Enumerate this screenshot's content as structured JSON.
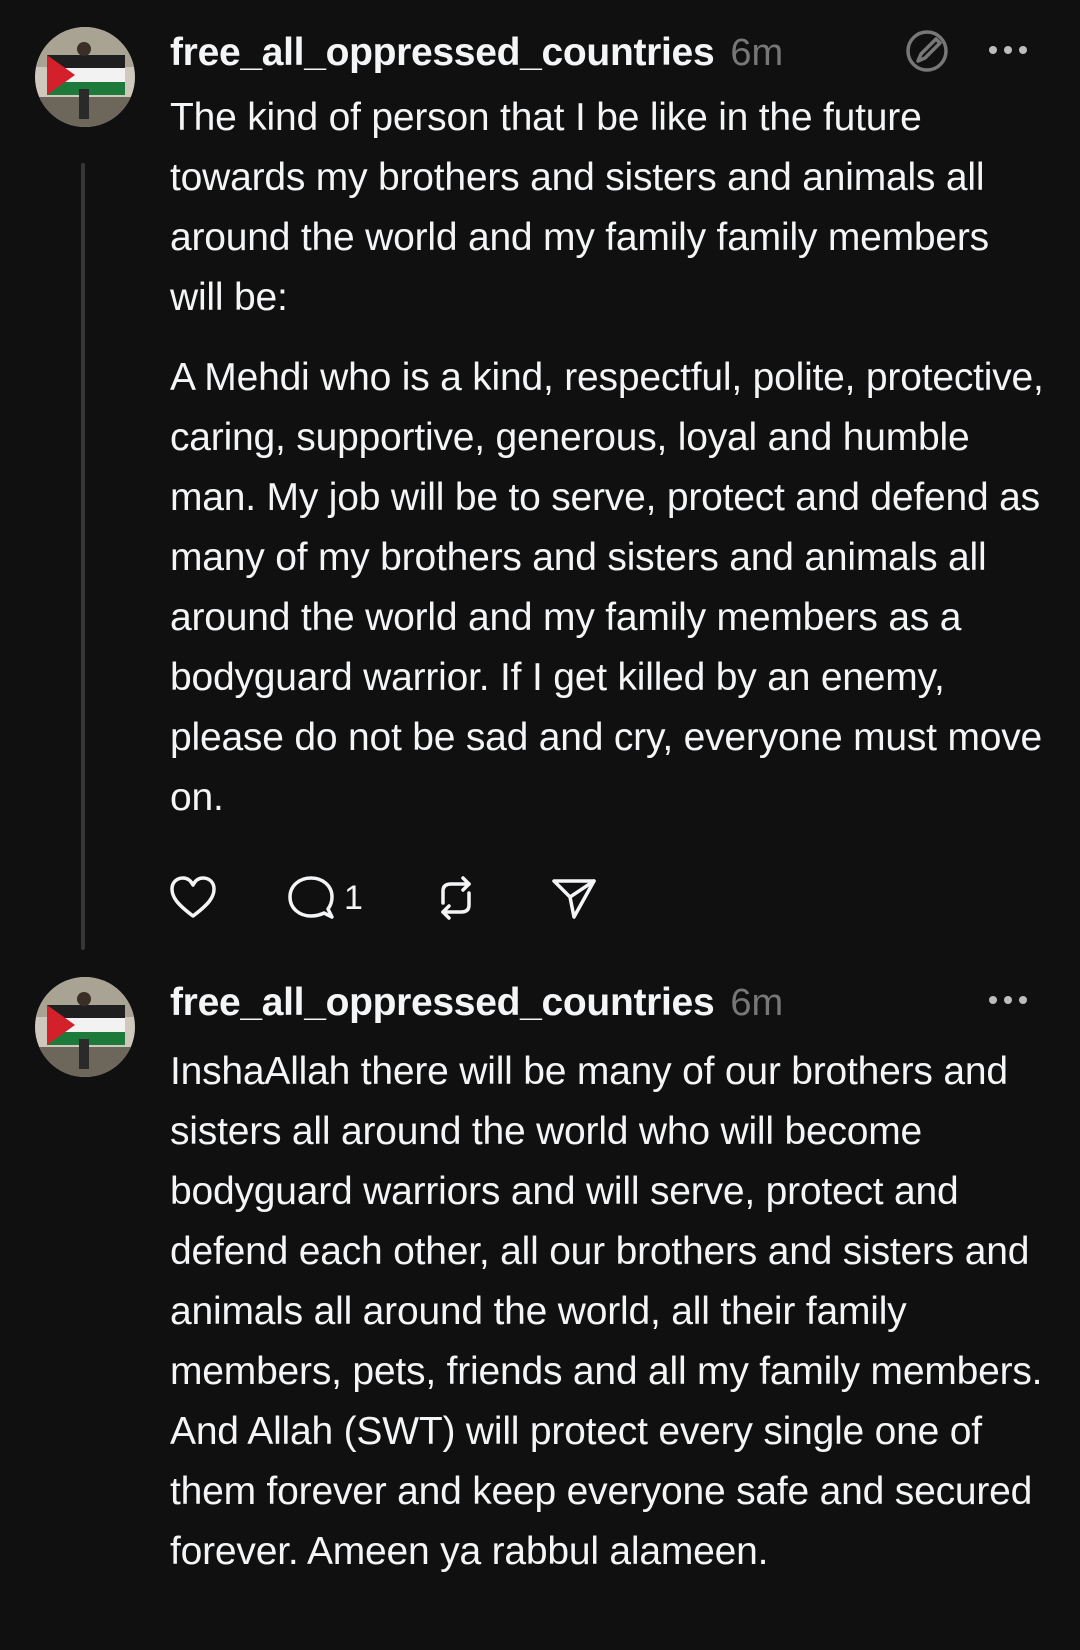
{
  "posts": [
    {
      "username": "free_all_oppressed_countries",
      "time": "6m",
      "paragraphs": [
        "The kind of person that I be like in the future towards my brothers and sisters and animals all around the world and my family family members will be:",
        "A Mehdi who is a kind, respectful, polite, protective, caring, supportive, generous, loyal and humble man. My job will be to serve, protect and defend as many of my brothers and sisters and animals all around the world and my family members as a bodyguard warrior. If I get killed by an enemy, please do not be sad and cry, everyone must move on."
      ],
      "comment_count": "1"
    },
    {
      "username": "free_all_oppressed_countries",
      "time": "6m",
      "paragraphs": [
        "InshaAllah there will be many of our brothers and sisters all around the world who will become bodyguard warriors and will serve, protect and defend each other, all our brothers and sisters and animals all around the world, all their family members, pets, friends and all my family members. And Allah (SWT) will protect every single one of them forever and keep everyone safe and secured forever. Ameen ya rabbul alameen."
      ]
    }
  ],
  "icons": {
    "edit": "edit-icon",
    "more": "more-icon",
    "like": "heart-icon",
    "comment": "comment-icon",
    "repost": "repost-icon",
    "share": "share-icon"
  },
  "colors": {
    "background": "#101010",
    "text": "#f3f5f7",
    "muted": "#777777",
    "thread_line": "#363636"
  }
}
